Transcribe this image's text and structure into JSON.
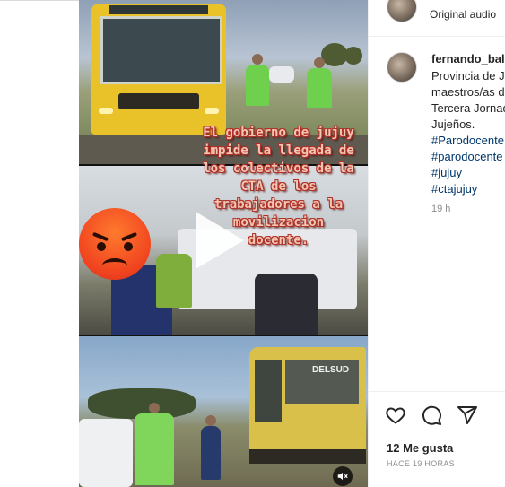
{
  "audio": {
    "label": "Original audio"
  },
  "post": {
    "username": "fernando_bal",
    "caption_lines": [
      "Provincia de J",
      "maestros/as d",
      "Tercera Jornad",
      "Jujeños."
    ],
    "hashtags": [
      "#Parodocente",
      "#parodocente",
      "#jujuy",
      "#ctajujuy"
    ],
    "time": "19 h",
    "likes": "12 Me gusta",
    "posted_ago": "HACE 19 HORAS"
  },
  "video": {
    "overlay_lines": [
      "El gobierno de jujuy",
      "impide la llegada de",
      "los colectivos de la",
      "CTA de los",
      "trabajadores a la",
      "movilizacion",
      "docente."
    ],
    "bus_destination": "DELSUD",
    "emoji": "angry-face-emoji",
    "play_icon": "play-icon",
    "mute_icon": "mute-icon"
  },
  "colors": {
    "hashtag": "#00376b",
    "meta": "#8e8e8e",
    "overlay_text": "#f2c7b2",
    "overlay_stroke": "#b0302a"
  }
}
